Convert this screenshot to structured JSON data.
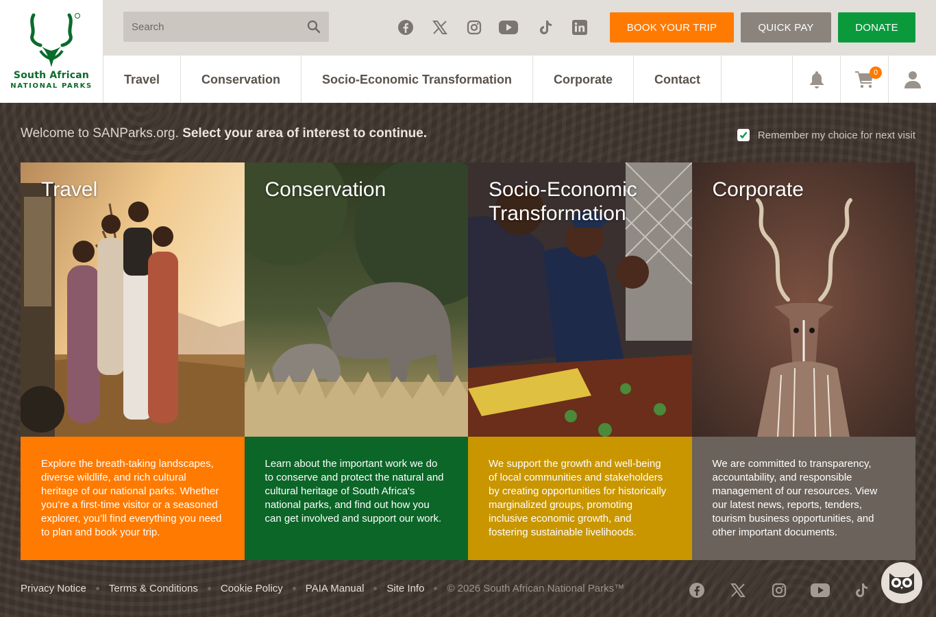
{
  "brand": {
    "logo_line1": "South African",
    "logo_line2": "NATIONAL PARKS",
    "green": "#0a6b2c"
  },
  "search": {
    "placeholder": "Search"
  },
  "social_icons": [
    "facebook-icon",
    "x-icon",
    "instagram-icon",
    "youtube-icon",
    "tiktok-icon",
    "linkedin-icon"
  ],
  "buttons": {
    "book": "BOOK YOUR TRIP",
    "pay": "QUICK PAY",
    "donate": "DONATE",
    "book_color": "#ff7a00",
    "pay_color": "#8b847d",
    "donate_color": "#0a9a3c"
  },
  "nav": {
    "items": [
      "Travel",
      "Conservation",
      "Socio-Economic Transformation",
      "Corporate",
      "Contact"
    ],
    "cart_count": "0"
  },
  "welcome": {
    "intro": "Welcome to SANParks.org.",
    "prompt": "Select your area of interest to continue.",
    "remember": "Remember my choice for next visit"
  },
  "cards": [
    {
      "title": "Travel",
      "desc": "Explore the breath-taking landscapes, diverse wildlife, and rich cultural heritage of our national parks. Whether you’re a first-time visitor or a seasoned explorer, you’ll find everything you need to plan and book your trip.",
      "color": "#ff7a00"
    },
    {
      "title": "Conservation",
      "desc": "Learn about the important work we do to conserve and protect the natural and cultural heritage of South Africa's national parks, and find out how you can get involved and support our work.",
      "color": "#0b6628"
    },
    {
      "title": "Socio-Economic Transformation",
      "desc": "We support the growth and well-being of local communities and stakeholders by creating opportunities for historically marginalized groups, promoting inclusive economic growth, and fostering sustainable livelihoods.",
      "color": "#c99600"
    },
    {
      "title": "Corporate",
      "desc": "We are committed to transparency, accountability, and responsible management of our resources. View our latest news, reports, tenders, tourism business opportunities, and other important documents.",
      "color": "#6b625b"
    }
  ],
  "footer": {
    "links": [
      "Privacy Notice",
      "Terms & Conditions",
      "Cookie Policy",
      "PAIA Manual",
      "Site Info"
    ],
    "copyright": "© 2026 South African National Parks™"
  }
}
